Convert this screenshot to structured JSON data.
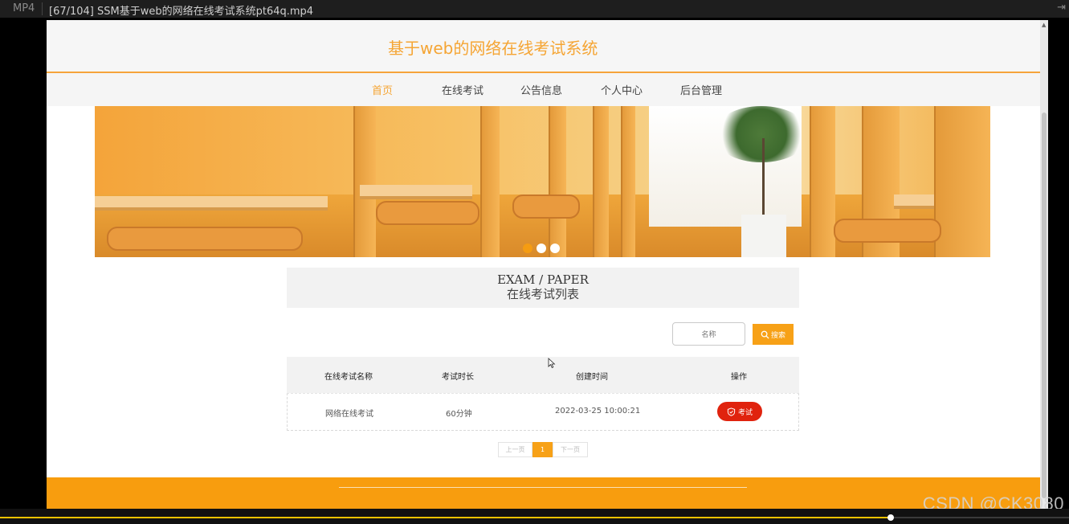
{
  "player": {
    "format": "MP4",
    "filename": "[67/104] SSM基于web的网络在线考试系统pt64q.mp4",
    "progress_fraction": 0.833,
    "watermark": "CSDN @CK3080"
  },
  "site": {
    "title": "基于web的网络在线考试系统",
    "accent_color": "#f5a534",
    "nav": [
      {
        "label": "首页",
        "active": true
      },
      {
        "label": "在线考试",
        "active": false
      },
      {
        "label": "公告信息",
        "active": false
      },
      {
        "label": "个人中心",
        "active": false
      },
      {
        "label": "后台管理",
        "active": false
      }
    ],
    "carousel": {
      "slides": 3,
      "active_index": 0
    }
  },
  "section": {
    "title_en": "EXAM / PAPER",
    "title_zh": "在线考试列表"
  },
  "search": {
    "placeholder": "名称",
    "button_label": "搜索",
    "button_icon": "search-icon"
  },
  "table": {
    "headers": [
      "在线考试名称",
      "考试时长",
      "创建时间",
      "操作"
    ],
    "rows": [
      {
        "name": "网络在线考试",
        "duration": "60分钟",
        "created": "2022-03-25 10:00:21",
        "action_label": "考试",
        "action_icon": "shield-check-icon"
      }
    ]
  },
  "pagination": {
    "prev": "上一页",
    "current": "1",
    "next": "下一页"
  }
}
